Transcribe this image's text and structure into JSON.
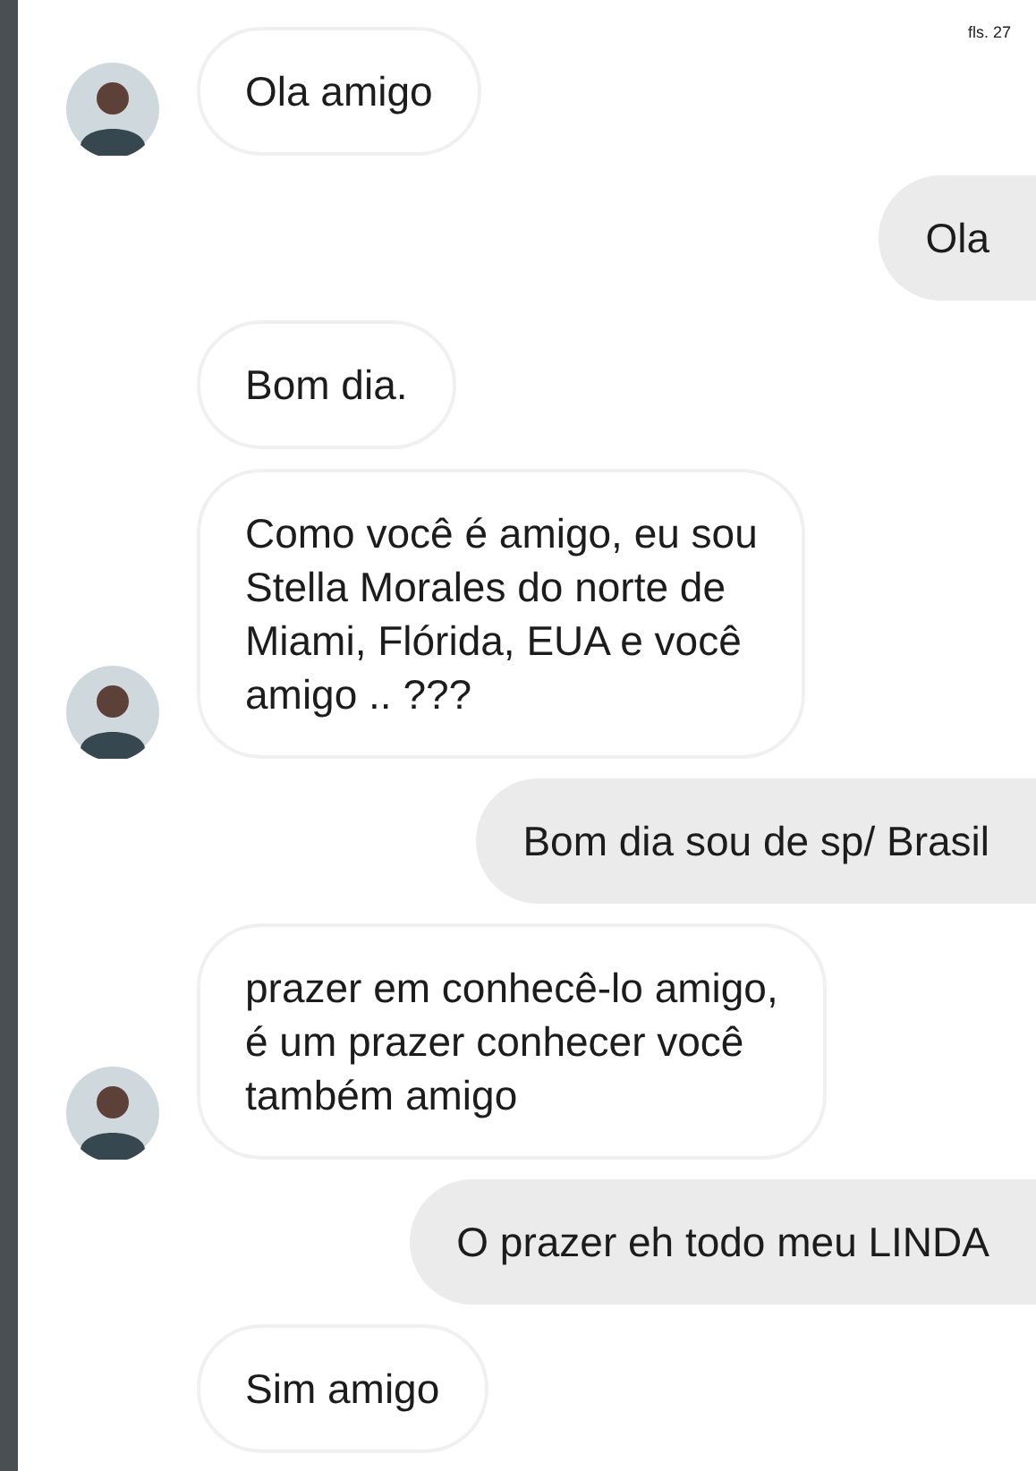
{
  "page_stamp": "fls. 27",
  "messages": [
    {
      "kind": "received",
      "avatar": true,
      "text": "Ola amigo"
    },
    {
      "kind": "sent",
      "text": "Ola"
    },
    {
      "kind": "received",
      "avatar": false,
      "text": "Bom dia."
    },
    {
      "kind": "received",
      "avatar": true,
      "text": "Como você é amigo, eu sou\nStella Morales do norte de\nMiami, Flórida, EUA e você\namigo .. ???"
    },
    {
      "kind": "sent",
      "text": "Bom dia sou de sp/ Brasil"
    },
    {
      "kind": "received",
      "avatar": true,
      "text": "prazer em conhecê-lo amigo,\né um prazer conhecer você\ntambém amigo"
    },
    {
      "kind": "sent",
      "text": "O prazer eh todo meu LINDA"
    },
    {
      "kind": "received",
      "avatar": false,
      "text": "Sim amigo"
    }
  ]
}
